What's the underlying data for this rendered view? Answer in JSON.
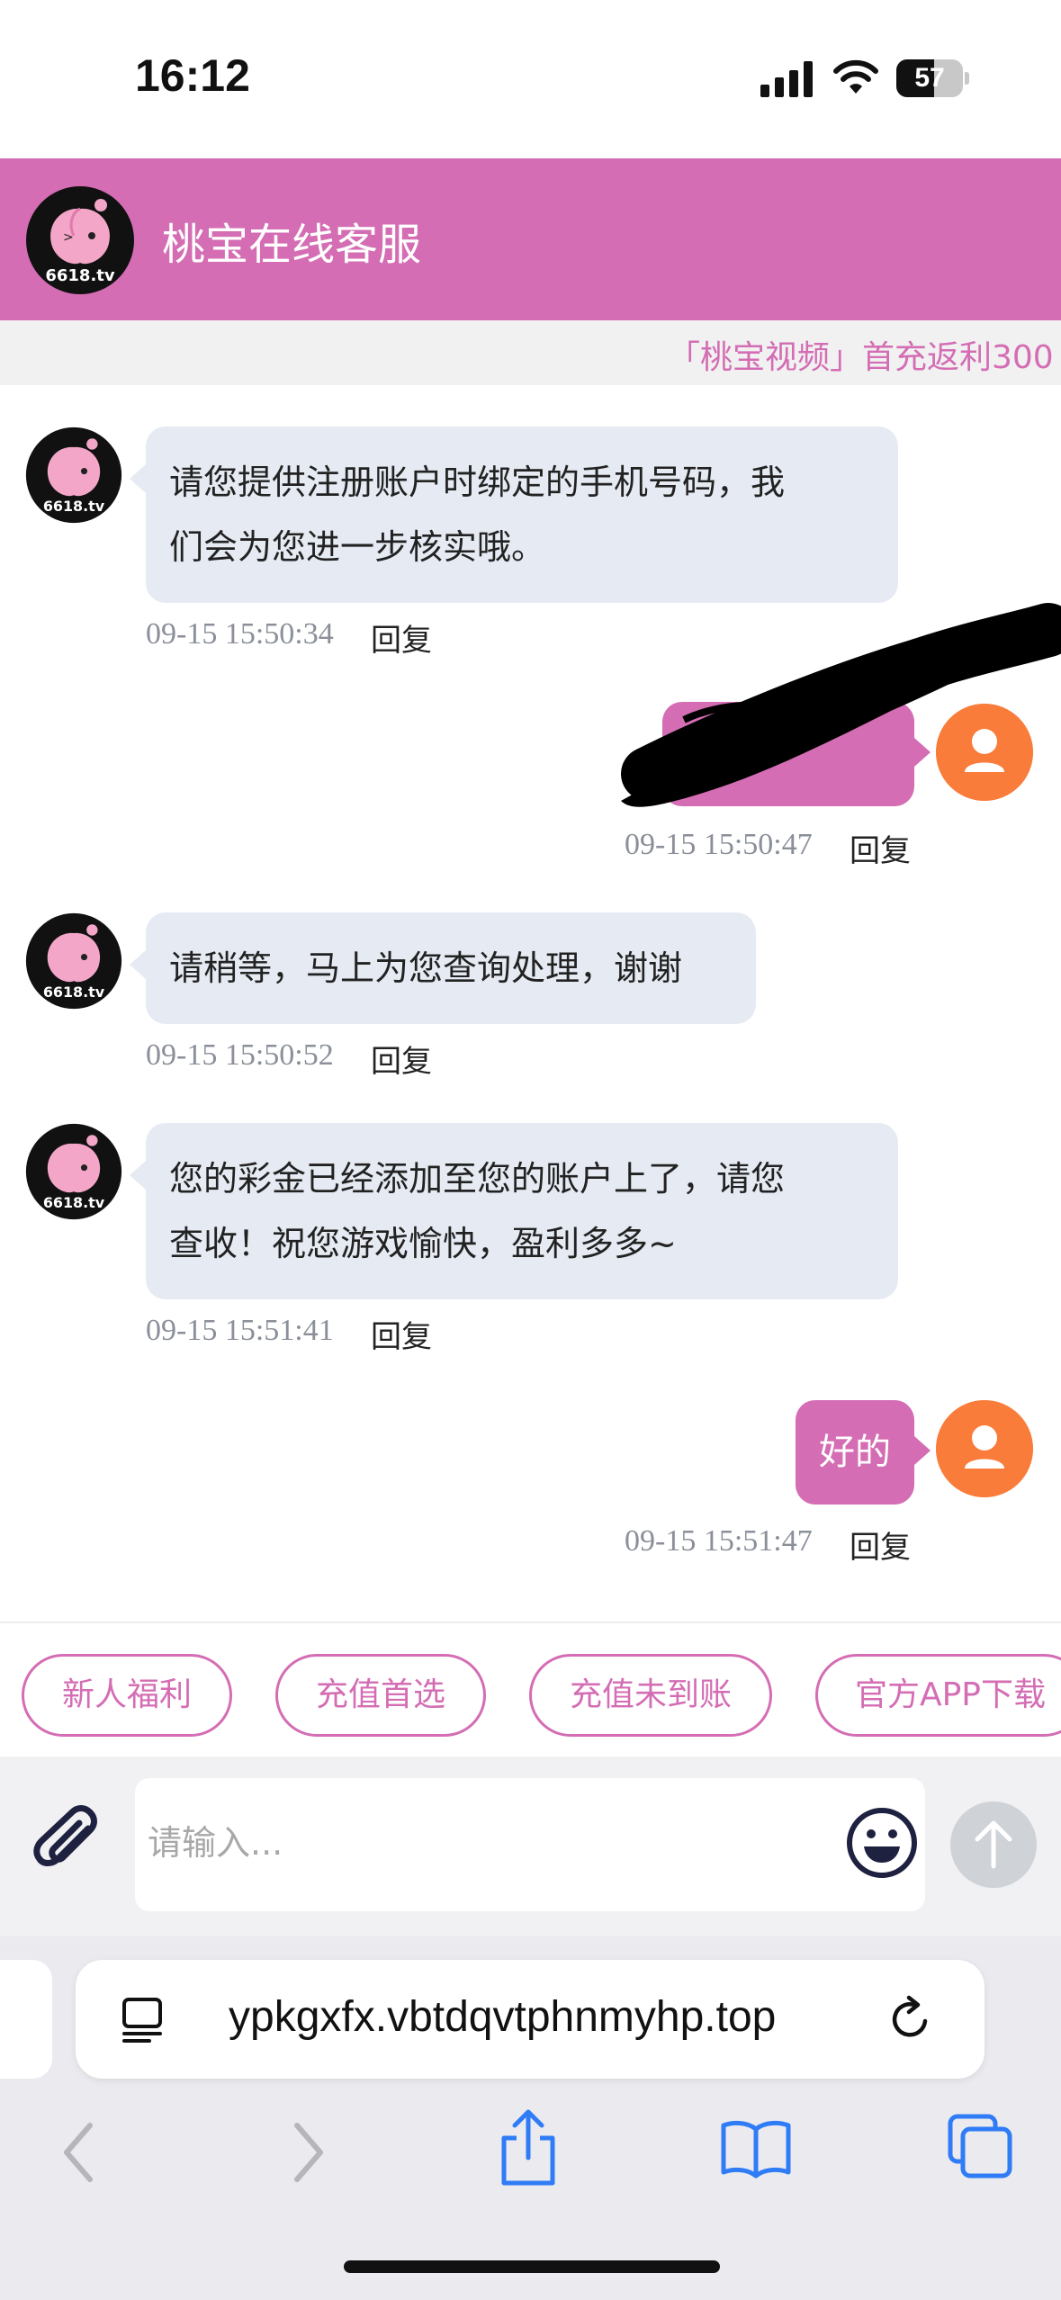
{
  "status_bar": {
    "time": "16:12",
    "battery": "57",
    "battery_level": 0.57
  },
  "header": {
    "title": "桃宝在线客服",
    "logo_text": "6618.tv"
  },
  "marquee": {
    "text": "「桃宝视频」首充返利300"
  },
  "messages": [
    {
      "side": "left",
      "text_lines": [
        "请您提供注册账户时绑定的手机号码，我",
        "们会为您进一步核实哦。"
      ],
      "time": "09-15 15:50:34",
      "reply": "回复"
    },
    {
      "side": "right",
      "text": "",
      "redacted": true,
      "time": "09-15 15:50:47",
      "reply": "回复"
    },
    {
      "side": "left",
      "text_lines": [
        "请稍等，马上为您查询处理，谢谢"
      ],
      "time": "09-15 15:50:52",
      "reply": "回复"
    },
    {
      "side": "left",
      "text_lines": [
        "您的彩金已经添加至您的账户上了，请您",
        "查收！祝您游戏愉快，盈利多多~"
      ],
      "time": "09-15 15:51:41",
      "reply": "回复"
    },
    {
      "side": "right",
      "text": "好的",
      "time": "09-15 15:51:47",
      "reply": "回复"
    }
  ],
  "quick_tags": [
    "新人福利",
    "充值首选",
    "充值未到账",
    "官方APP下载"
  ],
  "input": {
    "placeholder": "请输入..."
  },
  "browser": {
    "url": "ypkgxfx.vbtdqvtphnmyhp.top"
  },
  "colors": {
    "accent": "#d46db4",
    "user_avatar": "#f97c3a",
    "bubble_bg": "#e6ebf3",
    "safari_blue": "#2f7cf6"
  },
  "icons": [
    "attachment-icon",
    "emoji-icon",
    "send-arrow-icon",
    "page-menu-icon",
    "reload-icon",
    "back-icon",
    "forward-icon",
    "share-icon",
    "bookmarks-icon",
    "tabs-icon"
  ]
}
